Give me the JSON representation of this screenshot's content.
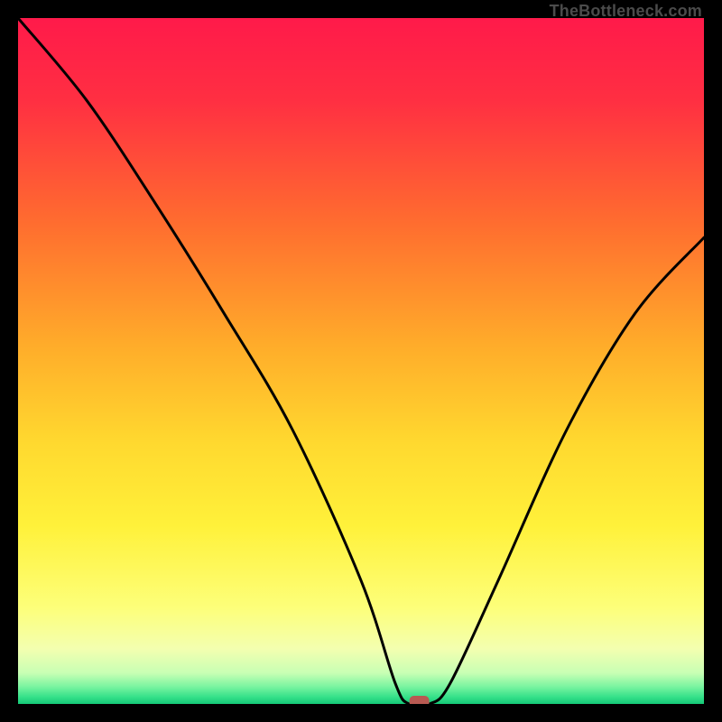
{
  "watermark": "TheBottleneck.com",
  "chart_data": {
    "type": "line",
    "title": "",
    "xlabel": "",
    "ylabel": "",
    "xlim": [
      0,
      100
    ],
    "ylim": [
      0,
      100
    ],
    "grid": false,
    "series": [
      {
        "name": "bottleneck-curve",
        "x": [
          0,
          10,
          20,
          30,
          40,
          50,
          55,
          57,
          60,
          63,
          70,
          80,
          90,
          100
        ],
        "values": [
          100,
          88,
          73,
          57,
          40,
          18,
          3,
          0,
          0,
          3,
          18,
          40,
          57,
          68
        ]
      }
    ],
    "annotations": [
      {
        "name": "optimal-marker",
        "x": 58.5,
        "y": 0,
        "shape": "rounded-rect",
        "color": "#b85a52"
      }
    ],
    "background_gradient_stops": [
      {
        "offset": 0.0,
        "color": "#ff1a4a"
      },
      {
        "offset": 0.12,
        "color": "#ff2f42"
      },
      {
        "offset": 0.3,
        "color": "#ff6d2f"
      },
      {
        "offset": 0.48,
        "color": "#ffad2a"
      },
      {
        "offset": 0.62,
        "color": "#ffd92f"
      },
      {
        "offset": 0.74,
        "color": "#fff13a"
      },
      {
        "offset": 0.86,
        "color": "#fdff7a"
      },
      {
        "offset": 0.92,
        "color": "#f3ffb0"
      },
      {
        "offset": 0.955,
        "color": "#c8ffb4"
      },
      {
        "offset": 0.975,
        "color": "#79f4a0"
      },
      {
        "offset": 0.99,
        "color": "#35e089"
      },
      {
        "offset": 1.0,
        "color": "#14c877"
      }
    ]
  }
}
